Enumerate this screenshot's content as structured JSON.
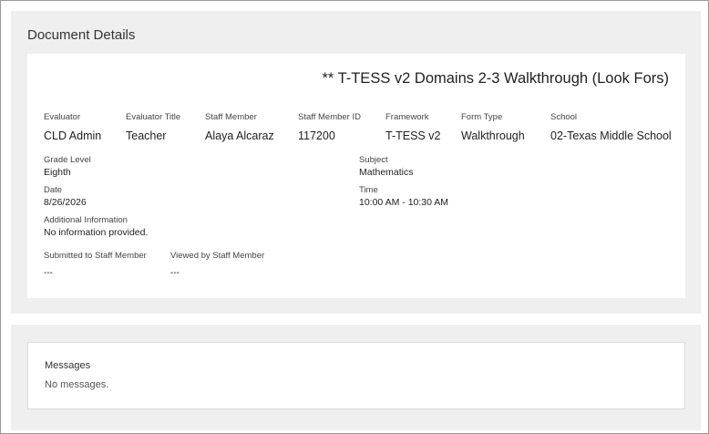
{
  "details": {
    "section_title": "Document Details",
    "document_title": "** T-TESS v2 Domains 2-3 Walkthrough (Look Fors)",
    "fields": {
      "evaluator": {
        "label": "Evaluator",
        "value": "CLD Admin"
      },
      "evaluator_title": {
        "label": "Evaluator Title",
        "value": "Teacher"
      },
      "staff_member": {
        "label": "Staff Member",
        "value": "Alaya Alcaraz"
      },
      "staff_member_id": {
        "label": "Staff Member ID",
        "value": "117200"
      },
      "framework": {
        "label": "Framework",
        "value": "T-TESS v2"
      },
      "form_type": {
        "label": "Form Type",
        "value": "Walkthrough"
      },
      "school": {
        "label": "School",
        "value": "02-Texas Middle School"
      },
      "grade_level": {
        "label": "Grade Level",
        "value": "Eighth"
      },
      "subject": {
        "label": "Subject",
        "value": "Mathematics"
      },
      "date": {
        "label": "Date",
        "value": "8/26/2026"
      },
      "time": {
        "label": "Time",
        "value": "10:00 AM - 10:30 AM"
      },
      "additional_information": {
        "label": "Additional Information",
        "value": "No information provided."
      },
      "submitted_to_staff": {
        "label": "Submitted to Staff Member",
        "value": "---"
      },
      "viewed_by_staff": {
        "label": "Viewed by Staff Member",
        "value": "---"
      }
    }
  },
  "messages": {
    "title": "Messages",
    "empty_text": "No messages."
  }
}
